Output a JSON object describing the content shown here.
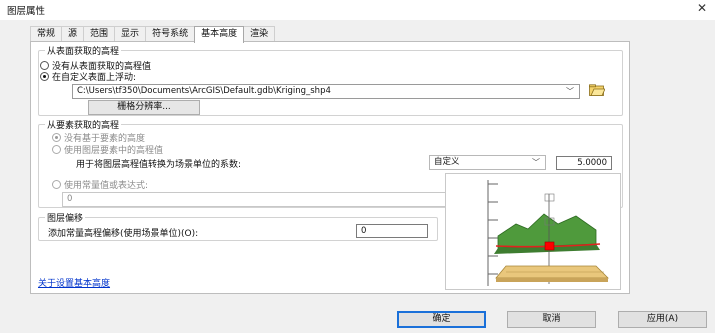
{
  "window": {
    "title": "图层属性",
    "close_glyph": "✕"
  },
  "tabs": [
    {
      "label": "常规"
    },
    {
      "label": "源"
    },
    {
      "label": "范围"
    },
    {
      "label": "显示"
    },
    {
      "label": "符号系统"
    },
    {
      "label": "基本高度"
    },
    {
      "label": "渲染"
    }
  ],
  "active_tab": "基本高度",
  "surface_group": {
    "title": "从表面获取的高程",
    "option_none": "没有从表面获取的高程值",
    "option_float": "在自定义表面上浮动:",
    "surface_path": "C:\\Users\\tf350\\Documents\\ArcGIS\\Default.gdb\\Kriging_shp4",
    "raster_button": "栅格分辨率..."
  },
  "feature_group": {
    "title": "从要素获取的高程",
    "option_no_feature": "没有基于要素的高度",
    "option_use_feature": "使用图层要素中的高程值",
    "conversion_label": "用于将图层高程值转换为场景单位的系数:",
    "conversion_unit": "自定义",
    "conversion_value": "5.0000",
    "option_constant": "使用常量值或表达式:",
    "constant_value": "0"
  },
  "offset_group": {
    "title": "图层偏移",
    "label": "添加常量高程偏移(使用场景单位)(O):",
    "value": "0"
  },
  "link": "关于设置基本高度",
  "footer": {
    "ok": "确定",
    "cancel": "取消",
    "apply": "应用(A)"
  },
  "colors": {
    "terrain": "#4f9a3c",
    "base_line": "#e0221e",
    "marker": "#ff0000",
    "ground_plane": "#e9c77c",
    "link": "#0033cc",
    "default_button_border": "#1a70d9"
  }
}
